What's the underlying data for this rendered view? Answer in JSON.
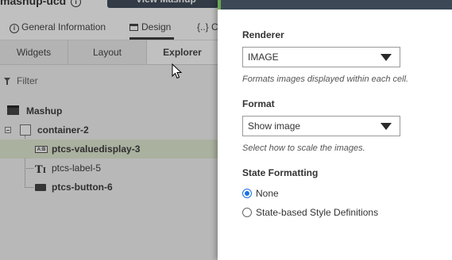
{
  "header": {
    "breadcrumb_title": "mashup-ucd",
    "view_button_label": "View Mashup"
  },
  "main_tabs": [
    {
      "label": "General Information"
    },
    {
      "label": "Design"
    },
    {
      "label": "{..} Co"
    }
  ],
  "sub_tabs": [
    {
      "label": "Widgets"
    },
    {
      "label": "Layout"
    },
    {
      "label": "Explorer"
    }
  ],
  "filter": {
    "placeholder": "Filter"
  },
  "tree": {
    "root": "Mashup",
    "container": "container-2",
    "children": [
      {
        "label": "ptcs-valuedisplay-3",
        "icon": "valuedisplay-icon",
        "selected": true
      },
      {
        "label": "ptcs-label-5",
        "icon": "label-icon",
        "selected": false
      },
      {
        "label": "ptcs-button-6",
        "icon": "button-icon",
        "selected": false
      }
    ]
  },
  "panel": {
    "renderer": {
      "title": "Renderer",
      "value": "IMAGE",
      "hint": "Formats images displayed within each cell."
    },
    "format": {
      "title": "Format",
      "value": "Show image",
      "hint": "Select how to scale the images."
    },
    "state_formatting": {
      "title": "State Formatting",
      "options": [
        {
          "label": "None",
          "checked": true
        },
        {
          "label": "State-based Style Definitions",
          "checked": false
        }
      ]
    }
  },
  "colors": {
    "accent_green": "#6aa84f",
    "header_dark": "#3c4856",
    "radio_blue": "#1a73e8",
    "selection": "#dfe9cf"
  }
}
